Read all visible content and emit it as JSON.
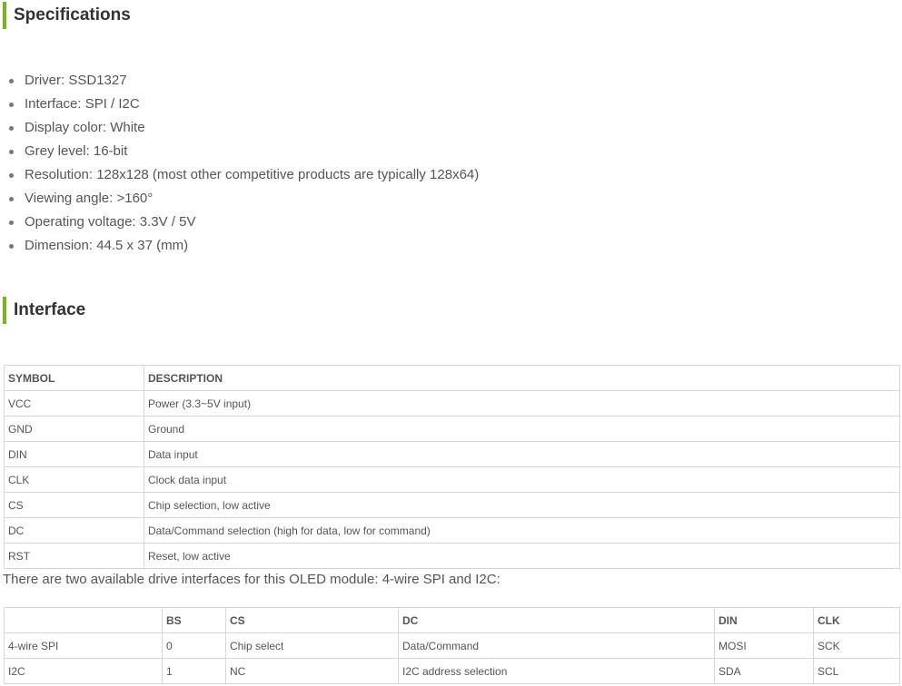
{
  "specifications": {
    "heading": "Specifications",
    "items": [
      "Driver: SSD1327",
      "Interface: SPI / I2C",
      "Display color: White",
      "Grey level: 16-bit",
      "Resolution: 128x128 (most other competitive products are typically 128x64)",
      "Viewing angle: >160°",
      "Operating voltage: 3.3V / 5V",
      "Dimension: 44.5 x 37 (mm)"
    ]
  },
  "interface": {
    "heading": "Interface",
    "pin_table": {
      "headers": [
        "SYMBOL",
        "DESCRIPTION"
      ],
      "rows": [
        [
          "VCC",
          "Power (3.3~5V input)"
        ],
        [
          "GND",
          "Ground"
        ],
        [
          "DIN",
          "Data input"
        ],
        [
          "CLK",
          "Clock data input"
        ],
        [
          "CS",
          "Chip selection, low active"
        ],
        [
          "DC",
          "Data/Command selection (high for data, low for command)"
        ],
        [
          "RST",
          "Reset, low active"
        ]
      ]
    },
    "note": "There are two available drive interfaces for this OLED module: 4-wire SPI and I2C:",
    "drive_table": {
      "headers": [
        "",
        "BS",
        "CS",
        "DC",
        "DIN",
        "CLK"
      ],
      "rows": [
        [
          "4-wire SPI",
          "0",
          "Chip select",
          "Data/Command",
          "MOSI",
          "SCK"
        ],
        [
          "I2C",
          "1",
          "NC",
          "I2C address selection",
          "SDA",
          "SCL"
        ]
      ]
    }
  },
  "colors": {
    "accent": "#79b31f",
    "text": "#555555",
    "heading": "#333333",
    "border": "#d8d8d8"
  }
}
